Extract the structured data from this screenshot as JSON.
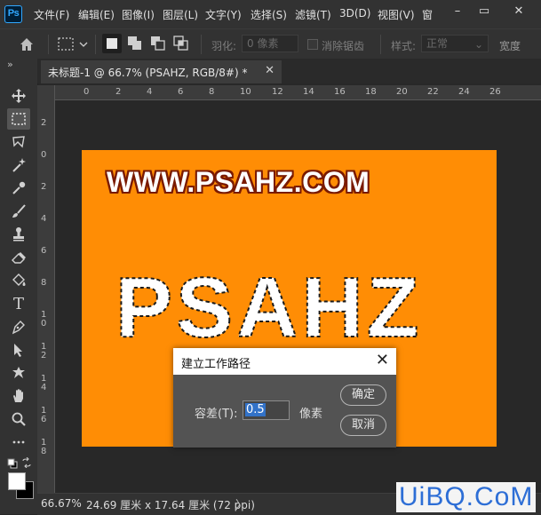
{
  "app": {
    "logo_text": "Ps",
    "menu": [
      "文件(F)",
      "编辑(E)",
      "图像(I)",
      "图层(L)",
      "文字(Y)",
      "选择(S)",
      "滤镜(T)",
      "3D(D)",
      "视图(V)",
      "窗"
    ],
    "window_controls": {
      "minimize": "–",
      "restore": "▭",
      "close": "✕"
    }
  },
  "options_bar": {
    "feather_label": "羽化:",
    "feather_value": "0 像素",
    "antialias_label": "消除锯齿",
    "style_label": "样式:",
    "style_value": "正常",
    "width_label": "宽度"
  },
  "tab": {
    "overflow_icon": "»",
    "title": "未标题-1 @ 66.7% (PSAHZ, RGB/8#) *",
    "close": "✕"
  },
  "rulers": {
    "h_ticks": [
      "0",
      "2",
      "4",
      "6",
      "8",
      "10",
      "12",
      "14",
      "16",
      "18",
      "20",
      "22",
      "24",
      "26"
    ],
    "v_ticks": [
      "2",
      "0",
      "2",
      "4",
      "6",
      "8",
      "1 0",
      "1 2",
      "1 4",
      "1 6",
      "1 8"
    ]
  },
  "canvas": {
    "url_text": "WWW.PSAHZ.COM",
    "selection_text": "PSAHZ",
    "background": "#ff8d05"
  },
  "dialog": {
    "title": "建立工作路径",
    "close": "✕",
    "tolerance_label": "容差(T):",
    "tolerance_value": "0.5",
    "unit": "像素",
    "ok": "确定",
    "cancel": "取消"
  },
  "status": {
    "zoom": "66.67%",
    "doc_size": "24.69 厘米 x 17.64 厘米 (72 ppi)",
    "arrow": "〉"
  },
  "watermark": "UiBQ.CoM",
  "colors": {
    "accent": "#31a8ff",
    "canvas_orange": "#ff8d05",
    "foreground": "#ffffff",
    "background": "#000000"
  }
}
